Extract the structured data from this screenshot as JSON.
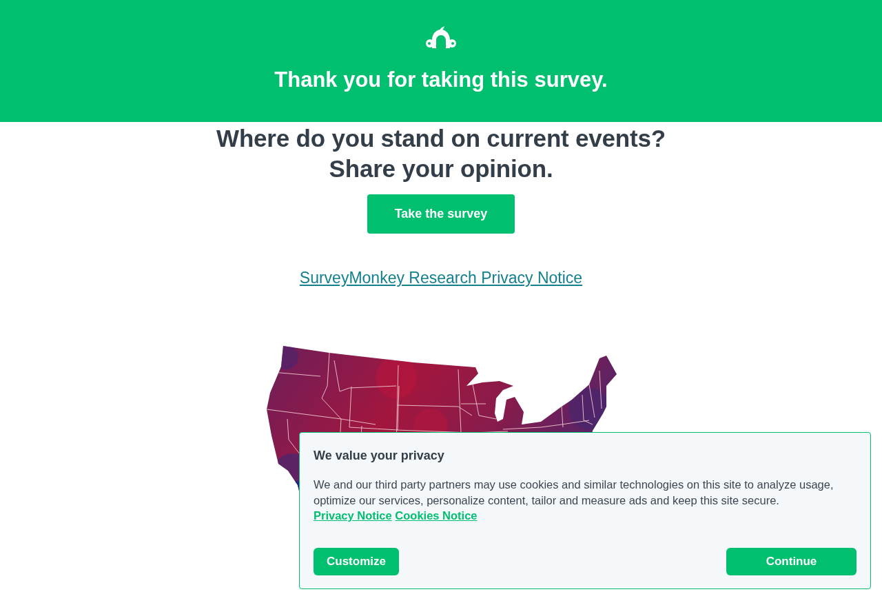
{
  "header": {
    "title": "Thank you for taking this survey."
  },
  "promo": {
    "headline": "Where do you stand on current events? Share your opinion.",
    "button": "Take the survey",
    "link": "SurveyMonkey Research Privacy Notice"
  },
  "cookie_banner": {
    "title": "We value your privacy",
    "body": "We and our third party partners may use cookies and similar technologies on this site to analyze usage, optimize our services, personalize content, tailor and measure ads and keep this site secure.",
    "links": [
      "Privacy Notice",
      "Cookies Notice"
    ],
    "buttons": [
      "Customize",
      "Continue"
    ]
  }
}
